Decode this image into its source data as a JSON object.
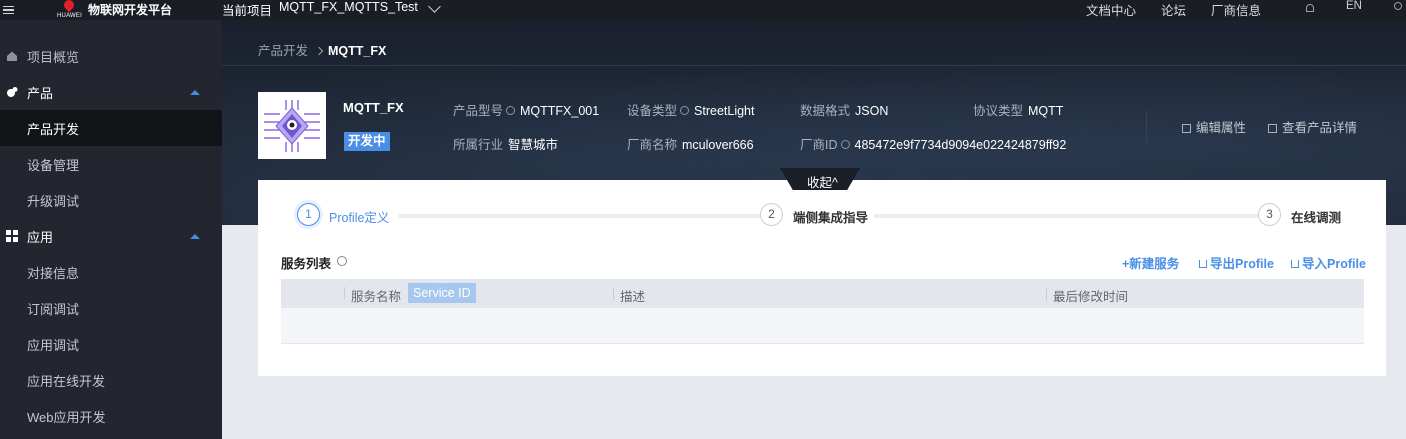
{
  "topbar": {
    "brand_small": "HUAWEI",
    "platform_title": "物联网开发平台",
    "project_label": "当前项目",
    "project_name": "MQTT_FX_MQTTS_Test",
    "nav": [
      "文档中心",
      "论坛",
      "厂商信息"
    ],
    "language": "EN"
  },
  "sidebar": {
    "overview": "项目概览",
    "product_group": "产品",
    "product_items": [
      "产品开发",
      "设备管理",
      "升级调试"
    ],
    "app_group": "应用",
    "app_items": [
      "对接信息",
      "订阅调试",
      "应用调试",
      "应用在线开发",
      "Web应用开发"
    ]
  },
  "breadcrumb": {
    "parent": "产品开发",
    "current": "MQTT_FX"
  },
  "product": {
    "name": "MQTT_FX",
    "status": "开发中",
    "model_label": "产品型号",
    "model_value": "MQTTFX_001",
    "device_type_label": "设备类型",
    "device_type_value": "StreetLight",
    "data_format_label": "数据格式",
    "data_format_value": "JSON",
    "protocol_label": "协议类型",
    "protocol_value": "MQTT",
    "industry_label": "所属行业",
    "industry_value": "智慧城市",
    "vendor_name_label": "厂商名称",
    "vendor_name_value": "mculover666",
    "vendor_id_label": "厂商ID",
    "vendor_id_value": "485472e9f7734d9094e022424879ff92",
    "edit_label": "编辑属性",
    "detail_label": "查看产品详情"
  },
  "collapse_label": "收起^",
  "steps": [
    {
      "num": "1",
      "label": "Profile定义"
    },
    {
      "num": "2",
      "label": "端侧集成指导"
    },
    {
      "num": "3",
      "label": "在线调测"
    }
  ],
  "services": {
    "title": "服务列表",
    "new_service": "+新建服务",
    "export_profile": "导出Profile",
    "import_profile": "导入Profile",
    "columns": [
      "服务名称",
      "Service ID",
      "描述",
      "最后修改时间"
    ]
  },
  "colors": {
    "accent": "#4a8fe6",
    "sidebar_bg": "#23262e",
    "topbar_bg": "#1b1d24"
  }
}
